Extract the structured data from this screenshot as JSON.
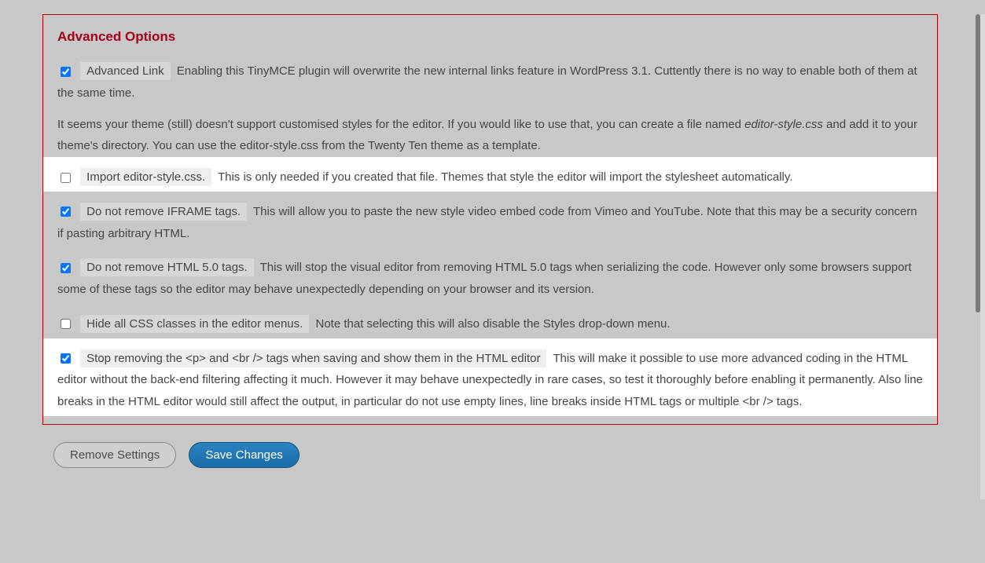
{
  "panel": {
    "title": "Advanced Options",
    "info_prefix": "It seems your theme (still) doesn't support customised styles for the editor. If you would like to use that, you can create a file named ",
    "info_filename": "editor-style.css",
    "info_suffix": " and add it to your theme's directory. You can use the editor-style.css from the Twenty Ten theme as a template."
  },
  "opts": {
    "advlink": {
      "label": "Advanced Link",
      "desc": "Enabling this TinyMCE plugin will overwrite the new internal links feature in WordPress 3.1. Cuttently there is no way to enable both of them at the same time."
    },
    "import": {
      "label": "Import editor-style.css.",
      "desc": "This is only needed if you created that file. Themes that style the editor will import the stylesheet automatically."
    },
    "iframe": {
      "label": "Do not remove IFRAME tags.",
      "desc": "This will allow you to paste the new style video embed code from Vimeo and YouTube. Note that this may be a security concern if pasting arbitrary HTML."
    },
    "html5": {
      "label": "Do not remove HTML 5.0 tags.",
      "desc": "This will stop the visual editor from removing HTML 5.0 tags when serializing the code. However only some browsers support some of these tags so the editor may behave unexpectedly depending on your browser and its version."
    },
    "hidecss": {
      "label": "Hide all CSS classes in the editor menus.",
      "desc": "Note that selecting this will also disable the Styles drop-down menu."
    },
    "stopptags": {
      "label": "Stop removing the <p> and <br /> tags when saving and show them in the HTML editor",
      "desc": "This will make it possible to use more advanced coding in the HTML editor without the back-end filtering affecting it much. However it may behave unexpectedly in rare cases, so test it thoroughly before enabling it permanently. Also line breaks in the HTML editor would still affect the output, in particular do not use empty lines, line breaks inside HTML tags or multiple <br /> tags."
    }
  },
  "buttons": {
    "remove": "Remove Settings",
    "save": "Save Changes"
  }
}
